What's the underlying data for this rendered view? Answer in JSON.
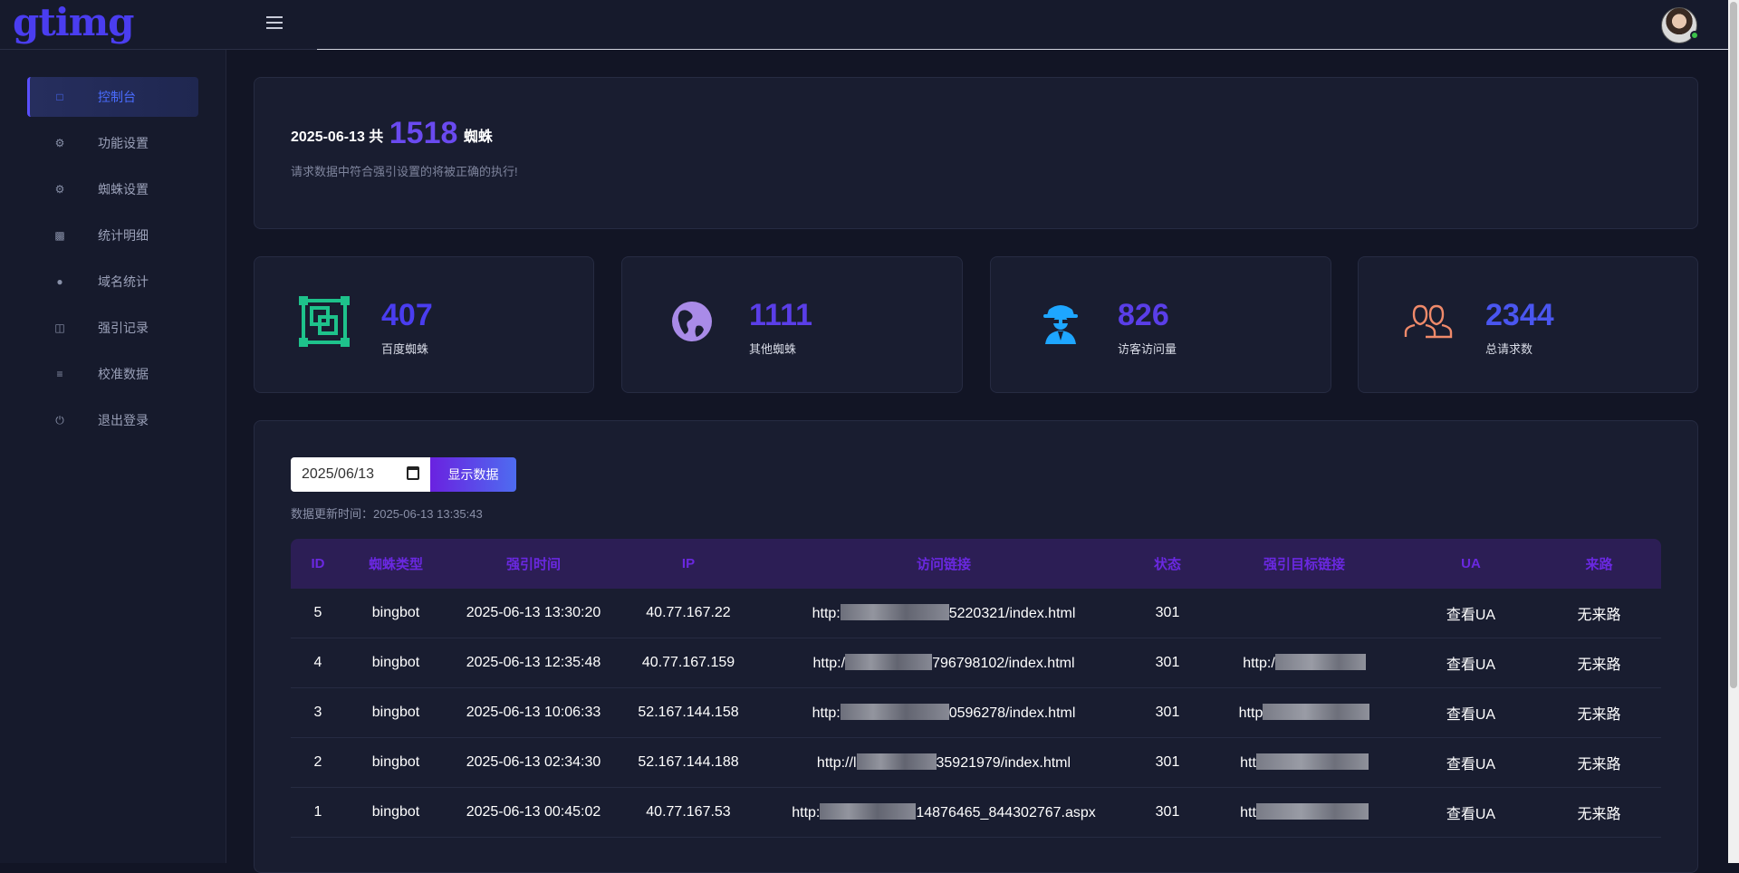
{
  "brand": {
    "logo": "gtimg"
  },
  "sidebar": {
    "items": [
      {
        "label": "控制台",
        "icon": "laptop-icon"
      },
      {
        "label": "功能设置",
        "icon": "gears-icon"
      },
      {
        "label": "蜘蛛设置",
        "icon": "gears-icon"
      },
      {
        "label": "统计明细",
        "icon": "bar-chart-icon"
      },
      {
        "label": "域名统计",
        "icon": "globe-icon"
      },
      {
        "label": "强引记录",
        "icon": "copy-icon"
      },
      {
        "label": "校准数据",
        "icon": "list-icon"
      },
      {
        "label": "退出登录",
        "icon": "power-icon"
      }
    ]
  },
  "summary": {
    "date": "2025-06-13",
    "gong": "共",
    "count": "1518",
    "unit": "蜘蛛",
    "note": "请求数据中符合强引设置的将被正确的执行!"
  },
  "stats": [
    {
      "value": "407",
      "label": "百度蜘蛛",
      "icon": "frame-icon",
      "color": "#1ec28b"
    },
    {
      "value": "1111",
      "label": "其他蜘蛛",
      "icon": "globe-americas-icon",
      "color": "#a98be8"
    },
    {
      "value": "826",
      "label": "访客访问量",
      "icon": "user-secret-icon",
      "color": "#1ea6ff"
    },
    {
      "value": "2344",
      "label": "总请求数",
      "icon": "users-icon",
      "color": "#f08a6a"
    }
  ],
  "filter": {
    "date_value": "2025/06/13",
    "button_label": "显示数据",
    "update_label": "数据更新时间：2025-06-13 13:35:43"
  },
  "table": {
    "headers": [
      "ID",
      "蜘蛛类型",
      "强引时间",
      "IP",
      "访问链接",
      "状态",
      "强引目标链接",
      "UA",
      "来路"
    ],
    "rows": [
      {
        "id": "5",
        "type": "bingbot",
        "time": "2025-06-13 13:30:20",
        "ip": "40.77.167.22",
        "link_pre": "http:",
        "link_post": "5220321/index.html",
        "status": "301",
        "target": "",
        "ua": "查看UA",
        "ref": "无来路"
      },
      {
        "id": "4",
        "type": "bingbot",
        "time": "2025-06-13 12:35:48",
        "ip": "40.77.167.159",
        "link_pre": "http:/",
        "link_post": "796798102/index.html",
        "status": "301",
        "target": "http:/",
        "ua": "查看UA",
        "ref": "无来路"
      },
      {
        "id": "3",
        "type": "bingbot",
        "time": "2025-06-13 10:06:33",
        "ip": "52.167.144.158",
        "link_pre": "http:",
        "link_post": "0596278/index.html",
        "status": "301",
        "target": "http",
        "ua": "查看UA",
        "ref": "无来路"
      },
      {
        "id": "2",
        "type": "bingbot",
        "time": "2025-06-13 02:34:30",
        "ip": "52.167.144.188",
        "link_pre": "http://l",
        "link_post": "35921979/index.html",
        "status": "301",
        "target": "htt",
        "ua": "查看UA",
        "ref": "无来路"
      },
      {
        "id": "1",
        "type": "bingbot",
        "time": "2025-06-13 00:45:02",
        "ip": "40.77.167.53",
        "link_pre": "http:",
        "link_post": "14876465_844302767.aspx",
        "status": "301",
        "target": "htt",
        "ua": "查看UA",
        "ref": "无来路"
      }
    ]
  }
}
